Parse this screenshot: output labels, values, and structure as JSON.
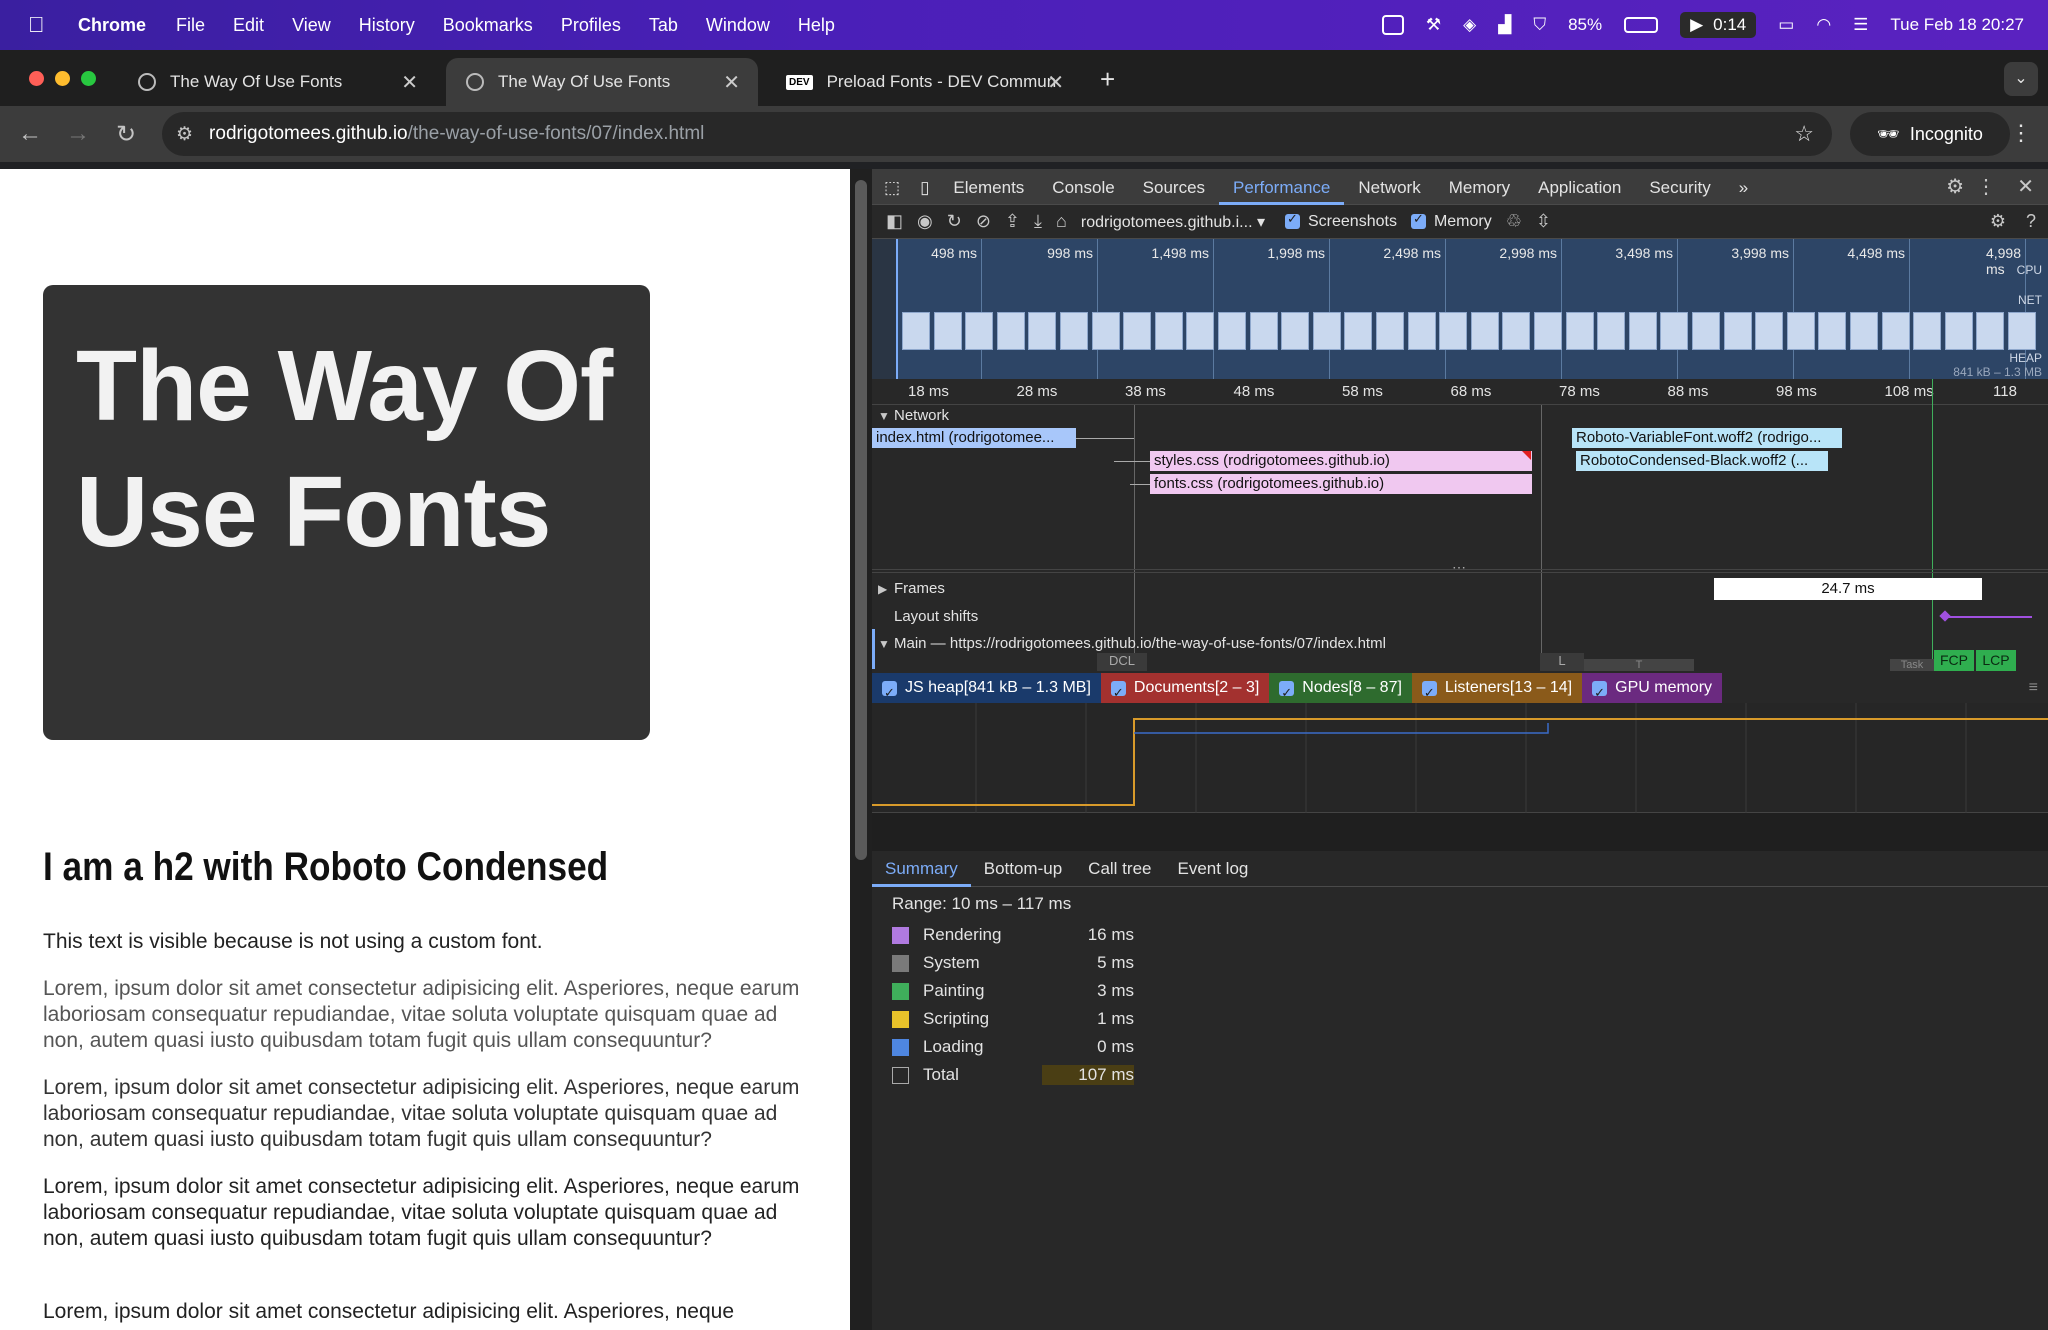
{
  "menubar": {
    "app": "Chrome",
    "items": [
      "File",
      "Edit",
      "View",
      "History",
      "Bookmarks",
      "Profiles",
      "Tab",
      "Window",
      "Help"
    ],
    "battery": "85%",
    "recording": "0:14",
    "datetime": "Tue Feb 18  20:27"
  },
  "tabs": [
    {
      "title": "The Way Of Use Fonts"
    },
    {
      "title": "The Way Of Use Fonts"
    },
    {
      "title": "Preload Fonts - DEV Commun",
      "favicon": "DEV"
    }
  ],
  "omnibox": {
    "host": "rodrigotomees.github.io",
    "path": "/the-way-of-use-fonts/07/index.html"
  },
  "incognito": "Incognito",
  "page": {
    "h1": "The Way Of Use Fonts",
    "h2": "I am a h2 with Roboto Condensed",
    "p1": "This text is visible because is not using a custom font.",
    "p2": "Lorem, ipsum dolor sit amet consectetur adipisicing elit. Asperiores, neque earum laboriosam consequatur repudiandae, vitae soluta voluptate quisquam quae ad non, autem quasi iusto quibusdam totam fugit quis ullam consequuntur?",
    "p3": "Lorem, ipsum dolor sit amet consectetur adipisicing elit. Asperiores, neque earum laboriosam consequatur repudiandae, vitae soluta voluptate quisquam quae ad non, autem quasi iusto quibusdam totam fugit quis ullam consequuntur?",
    "p4": "Lorem, ipsum dolor sit amet consectetur adipisicing elit. Asperiores, neque earum laboriosam consequatur repudiandae, vitae soluta voluptate quisquam quae ad non, autem quasi iusto quibusdam totam fugit quis ullam consequuntur?",
    "p5": "Lorem, ipsum dolor sit amet consectetur adipisicing elit. Asperiores, neque"
  },
  "devtools": {
    "tabs": [
      "Elements",
      "Console",
      "Sources",
      "Performance",
      "Network",
      "Memory",
      "Application",
      "Security"
    ],
    "active_tab": "Performance",
    "target": "rodrigotomees.github.i...",
    "screenshots": "Screenshots",
    "memory": "Memory",
    "overview_labels": [
      "498 ms",
      "998 ms",
      "1,498 ms",
      "1,998 ms",
      "2,498 ms",
      "2,998 ms",
      "3,498 ms",
      "3,998 ms",
      "4,498 ms",
      "4,998 ms"
    ],
    "overview_tracks": {
      "cpu": "CPU",
      "net": "NET",
      "heap": "HEAP",
      "heap_range": "841 kB – 1.3 MB"
    },
    "ruler": [
      "18 ms",
      "28 ms",
      "38 ms",
      "48 ms",
      "58 ms",
      "68 ms",
      "78 ms",
      "88 ms",
      "98 ms",
      "108 ms",
      "118"
    ],
    "network_label": "Network",
    "requests": [
      {
        "label": "index.html (rodrigotomee...",
        "color": "#a8c7fa"
      },
      {
        "label": "styles.css (rodrigotomees.github.io)",
        "color": "#f0c8f0"
      },
      {
        "label": "fonts.css (rodrigotomees.github.io)",
        "color": "#f0c8f0"
      },
      {
        "label": "Roboto-VariableFont.woff2 (rodrigo...",
        "color": "#b8e4f8"
      },
      {
        "label": "RobotoCondensed-Black.woff2 (...",
        "color": "#b8e4f8"
      }
    ],
    "frames_label": "Frames",
    "frame_time": "24.7 ms",
    "layout_shifts": "Layout shifts",
    "main_label": "Main — https://rodrigotomees.github.io/the-way-of-use-fonts/07/index.html",
    "markers": {
      "dcl": "DCL",
      "l": "L",
      "t": "T",
      "task": "Task",
      "fcp": "FCP",
      "lcp": "LCP"
    },
    "counters": [
      {
        "label": "JS heap[841 kB – 1.3 MB]",
        "color": "#1a3a6b"
      },
      {
        "label": "Documents[2 – 3]",
        "color": "#a3312f"
      },
      {
        "label": "Nodes[8 – 87]",
        "color": "#2e6b2e"
      },
      {
        "label": "Listeners[13 – 14]",
        "color": "#8a5a1a"
      },
      {
        "label": "GPU memory",
        "color": "#6b2a80"
      }
    ],
    "bottom_tabs": [
      "Summary",
      "Bottom-up",
      "Call tree",
      "Event log"
    ],
    "range": "Range: 10 ms – 117 ms",
    "summary": [
      {
        "name": "Rendering",
        "value": "16 ms",
        "color": "#b07ae0"
      },
      {
        "name": "System",
        "value": "5 ms",
        "color": "#7a7a7a"
      },
      {
        "name": "Painting",
        "value": "3 ms",
        "color": "#3fae5b"
      },
      {
        "name": "Scripting",
        "value": "1 ms",
        "color": "#e8c22a"
      },
      {
        "name": "Loading",
        "value": "0 ms",
        "color": "#4e86e0"
      },
      {
        "name": "Total",
        "value": "107 ms",
        "color": "transparent"
      }
    ]
  }
}
